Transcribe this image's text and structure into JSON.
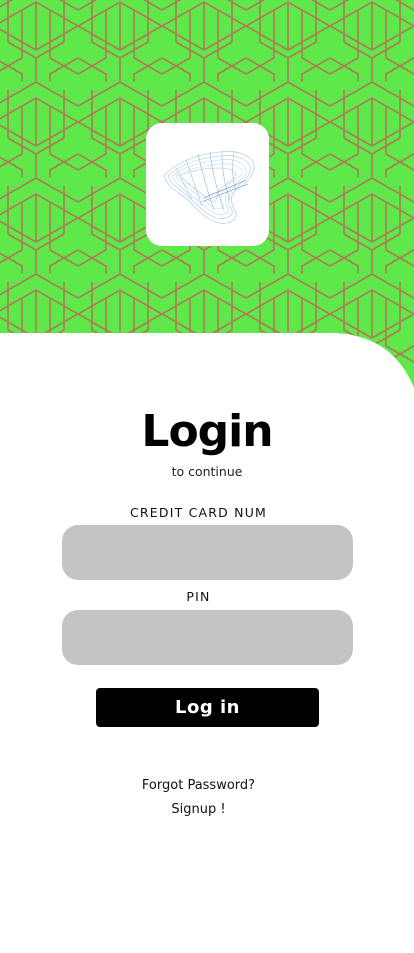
{
  "colors": {
    "hero_background": "#5ee84a",
    "hero_pattern_lines": "#b07a55",
    "input_background": "#c4c4c4",
    "button_background": "#000000",
    "button_text": "#ffffff"
  },
  "logo": {
    "icon": "wave-mesh-logo-icon"
  },
  "login": {
    "title": "Login",
    "subtitle": "to continue",
    "card_label": "CREDIT CARD NUM",
    "card_value": "",
    "pin_label": "PIN",
    "pin_value": "",
    "button_label": "Log in"
  },
  "links": {
    "forgot": "Forgot Password?",
    "signup": "Signup !"
  }
}
